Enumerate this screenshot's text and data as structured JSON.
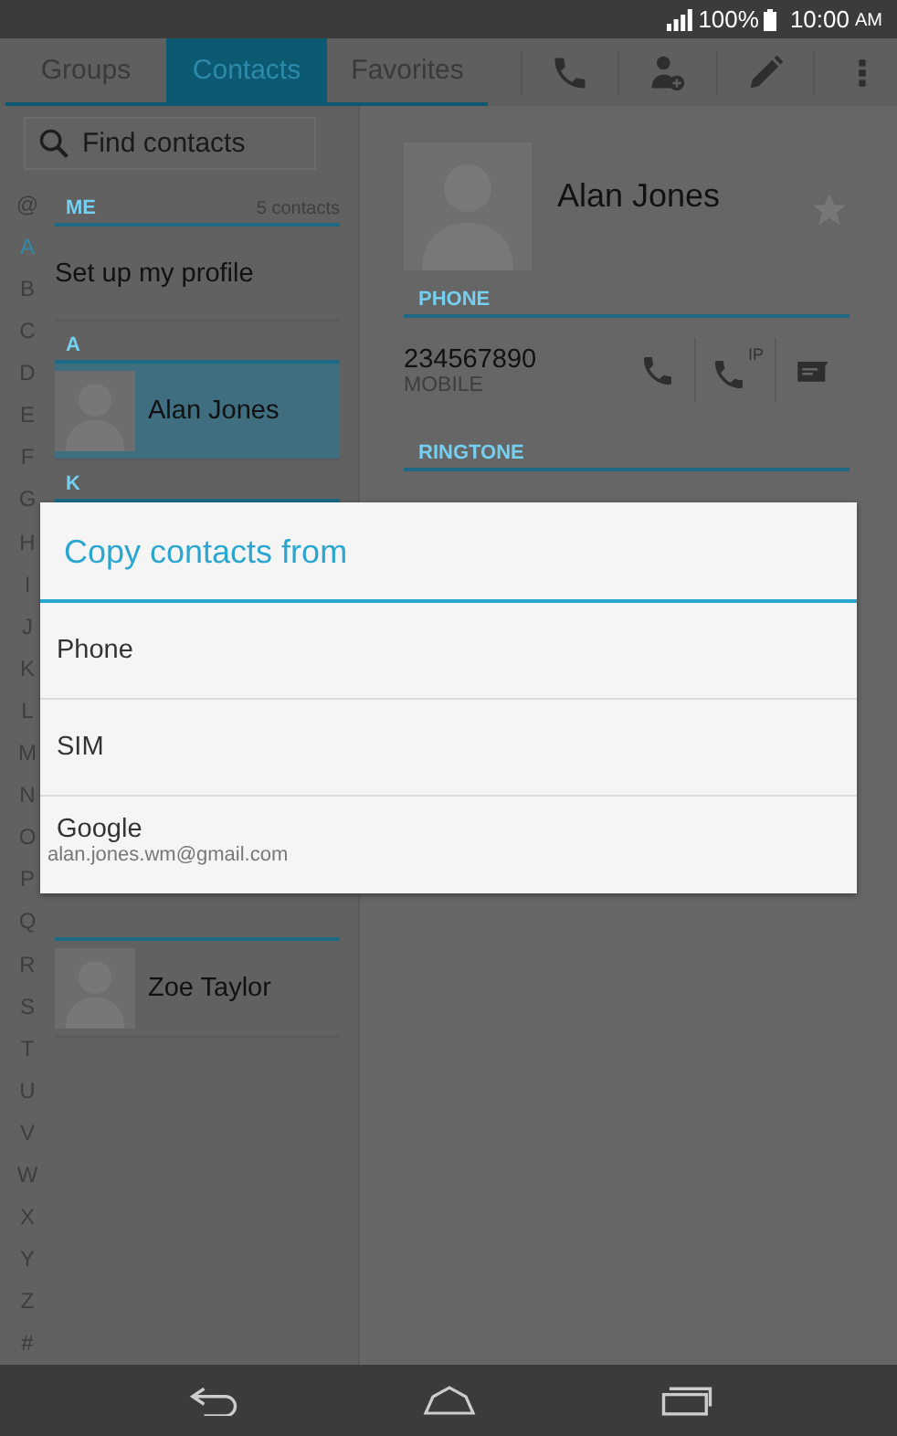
{
  "status_bar": {
    "battery": "100%",
    "time": "10:00",
    "period": "AM"
  },
  "tabs": [
    {
      "label": "Groups",
      "selected": false
    },
    {
      "label": "Contacts",
      "selected": true
    },
    {
      "label": "Favorites",
      "selected": false
    }
  ],
  "search": {
    "placeholder": "Find contacts"
  },
  "index": [
    {
      "letter": "@",
      "selected": false
    },
    {
      "letter": "A",
      "selected": true
    },
    {
      "letter": "B",
      "selected": false
    },
    {
      "letter": "C",
      "selected": false
    },
    {
      "letter": "D",
      "selected": false
    },
    {
      "letter": "E",
      "selected": false
    },
    {
      "letter": "F",
      "selected": false
    },
    {
      "letter": "G",
      "selected": false
    },
    {
      "letter": "H",
      "selected": false
    },
    {
      "letter": "I",
      "selected": false
    },
    {
      "letter": "J",
      "selected": false
    },
    {
      "letter": "K",
      "selected": false
    },
    {
      "letter": "L",
      "selected": false
    },
    {
      "letter": "M",
      "selected": false
    },
    {
      "letter": "N",
      "selected": false
    },
    {
      "letter": "O",
      "selected": false
    },
    {
      "letter": "P",
      "selected": false
    },
    {
      "letter": "Q",
      "selected": false
    },
    {
      "letter": "R",
      "selected": false
    },
    {
      "letter": "S",
      "selected": false
    },
    {
      "letter": "T",
      "selected": false
    },
    {
      "letter": "U",
      "selected": false
    },
    {
      "letter": "V",
      "selected": false
    },
    {
      "letter": "W",
      "selected": false
    },
    {
      "letter": "X",
      "selected": false
    },
    {
      "letter": "Y",
      "selected": false
    },
    {
      "letter": "Z",
      "selected": false
    },
    {
      "letter": "#",
      "selected": false
    }
  ],
  "list": [
    {
      "kind": "header",
      "label": "ME",
      "count": "5 contacts"
    },
    {
      "kind": "profile",
      "label": "Set up my profile"
    },
    {
      "kind": "header",
      "label": "A"
    },
    {
      "kind": "contact",
      "name": "Alan Jones",
      "selected": true
    },
    {
      "kind": "header",
      "label": "K"
    },
    {
      "kind": "divider"
    },
    {
      "kind": "contact",
      "name": "Zoe Taylor",
      "selected": false
    }
  ],
  "detail": {
    "name": "Alan Jones",
    "starred": false,
    "phone_header": "PHONE",
    "number": "234567890",
    "number_type": "MOBILE",
    "ip_label": "IP",
    "ringtone_header": "RINGTONE"
  },
  "dialog": {
    "title": "Copy contacts from",
    "options": [
      {
        "label": "Phone"
      },
      {
        "label": "SIM"
      },
      {
        "label": "Google",
        "sub": "alan.jones.wm@gmail.com"
      }
    ]
  }
}
